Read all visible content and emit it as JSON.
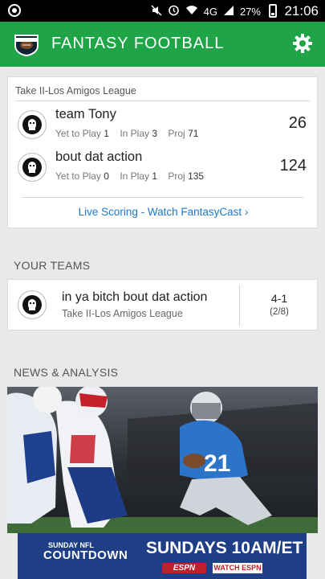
{
  "status_bar": {
    "network": "4G",
    "battery": "27%",
    "time": "21:06"
  },
  "app_bar": {
    "title": "FANTASY FOOTBALL",
    "logo_icon": "fantasy-football-logo-icon",
    "settings_icon": "gear-icon"
  },
  "scoreboard": {
    "league": "Take II-Los Amigos League",
    "teams": [
      {
        "name": "team Tony",
        "yet_label": "Yet to Play",
        "yet": "1",
        "inplay_label": "In Play",
        "inplay": "3",
        "proj_label": "Proj",
        "proj": "71",
        "score": "26"
      },
      {
        "name": "bout dat action",
        "yet_label": "Yet to Play",
        "yet": "0",
        "inplay_label": "In Play",
        "inplay": "1",
        "proj_label": "Proj",
        "proj": "135",
        "score": "124"
      }
    ],
    "live_link": "Live Scoring - Watch FantasyCast ›"
  },
  "your_teams": {
    "heading": "YOUR TEAMS",
    "team": {
      "name": "in ya bitch bout dat action",
      "league": "Take II-Los Amigos League",
      "record": "4-1",
      "rank": "(2/8)"
    }
  },
  "news": {
    "heading": "NEWS & ANALYSIS"
  },
  "ad": {
    "line1": "SUNDAY NFL",
    "line2": "COUNTDOWN",
    "headline": "SUNDAYS 10AM/ET",
    "espn": "ESPN",
    "watch": "WATCH ESPN"
  },
  "colors": {
    "appbar": "#1fa447",
    "link": "#1c78c9",
    "ad_bg": "#1e3e86"
  }
}
